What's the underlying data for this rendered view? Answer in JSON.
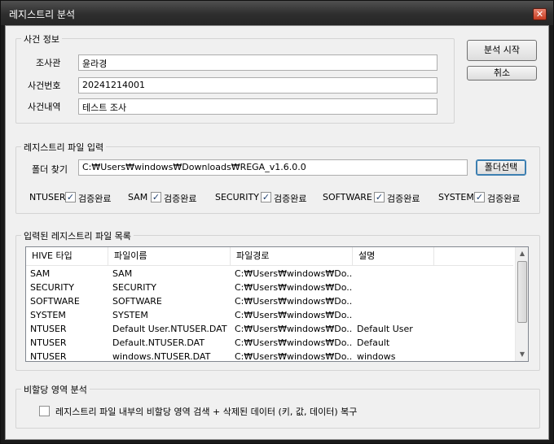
{
  "window": {
    "title": "레지스트리 분석",
    "close_glyph": "✕"
  },
  "case_info": {
    "legend": "사건 정보",
    "investigator_label": "조사관",
    "investigator_value": "윤라경",
    "case_number_label": "사건번호",
    "case_number_value": "20241214001",
    "case_desc_label": "사건내역",
    "case_desc_value": "테스트 조사"
  },
  "actions": {
    "start_label": "분석 시작",
    "cancel_label": "취소"
  },
  "registry_input": {
    "legend": "레지스트리 파일 입력",
    "folder_label": "폴더 찾기",
    "folder_value": "C:₩Users₩windows₩Downloads₩REGA_v1.6.0.0",
    "browse_label": "폴더선택",
    "hives": [
      {
        "name": "NTUSER",
        "status": "검증완료",
        "checked": true
      },
      {
        "name": "SAM",
        "status": "검증완료",
        "checked": true
      },
      {
        "name": "SECURITY",
        "status": "검증완료",
        "checked": true
      },
      {
        "name": "SOFTWARE",
        "status": "검증완료",
        "checked": true
      },
      {
        "name": "SYSTEM",
        "status": "검증완료",
        "checked": true
      }
    ]
  },
  "file_list": {
    "legend": "입력된 레지스트리 파일 목록",
    "columns": [
      "HIVE 타입",
      "파일이름",
      "파일경로",
      "설명"
    ],
    "rows": [
      [
        "SAM",
        "SAM",
        "C:₩Users₩windows₩Do...",
        ""
      ],
      [
        "SECURITY",
        "SECURITY",
        "C:₩Users₩windows₩Do...",
        ""
      ],
      [
        "SOFTWARE",
        "SOFTWARE",
        "C:₩Users₩windows₩Do...",
        ""
      ],
      [
        "SYSTEM",
        "SYSTEM",
        "C:₩Users₩windows₩Do...",
        ""
      ],
      [
        "NTUSER",
        "Default User.NTUSER.DAT",
        "C:₩Users₩windows₩Do...",
        "Default User"
      ],
      [
        "NTUSER",
        "Default.NTUSER.DAT",
        "C:₩Users₩windows₩Do...",
        "Default"
      ],
      [
        "NTUSER",
        "windows.NTUSER.DAT",
        "C:₩Users₩windows₩Do...",
        "windows"
      ]
    ]
  },
  "unallocated": {
    "legend": "비할당 영역 분석",
    "option_label": "레지스트리 파일 내부의 비할당 영역 검색 + 삭제된 데이터 (키, 값, 데이터) 복구",
    "checked": false
  }
}
